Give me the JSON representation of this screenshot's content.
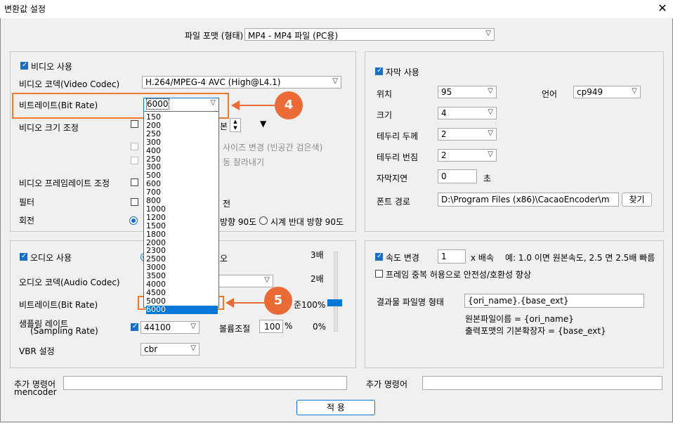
{
  "window": {
    "title": "변환값 설정",
    "close": "✕"
  },
  "format": {
    "label": "파일 포맷 (형태)",
    "value": "MP4 - MP4 파일 (PC용)"
  },
  "video": {
    "use_label": "비디오 사용",
    "codec_label": "비디오 코덱(Video Codec)",
    "codec_value": "H.264/MPEG-4 AVC (High@L4.1)",
    "bitrate_label": "비트레이트(Bit Rate)",
    "bitrate_value": "6000",
    "size_label": "비디오 크기 조정",
    "size_suffix": "본",
    "size_opt1": "사이즈 변경 (빈공간 검은색)",
    "size_opt2": "동 잘라내기",
    "framerate_label": "비디오 프레임레이트 조정",
    "filter_label": "필터",
    "filter_suffix": "전",
    "rotate_label": "회전",
    "rotate_opt_cw_partial": "방향 90도",
    "rotate_opt_ccw": "시계 반대 방향 90도",
    "bitrate_options": [
      "150",
      "200",
      "250",
      "300",
      "400",
      "250",
      "300",
      "500",
      "600",
      "700",
      "800",
      "1000",
      "1200",
      "1500",
      "1800",
      "2000",
      "2300",
      "2500",
      "3000",
      "3500",
      "4000",
      "4500",
      "5000",
      "6000"
    ]
  },
  "subtitle": {
    "use_label": "자막 사용",
    "position_label": "위치",
    "position_value": "95",
    "lang_label": "언어",
    "lang_value": "cp949",
    "size_label": "크기",
    "size_value": "4",
    "border_w_label": "테두리 두께",
    "border_w_value": "2",
    "border_b_label": "테두리 번짐",
    "border_b_value": "2",
    "delay_label": "자막지연",
    "delay_value": "0",
    "delay_unit": "초",
    "font_label": "폰트 경로",
    "font_value": "D:\\Program Files (x86)\\CacaoEncoder\\m",
    "browse_label": "찾기"
  },
  "audio": {
    "use_label": "오디오 사용",
    "use_suffix": "오",
    "codec_label": "오디오 코덱(Audio Codec)",
    "bitrate_label": "비트레이트(Bit Rate)",
    "bitrate_value": "6000",
    "sampling_label1": "샘플링 레이트",
    "sampling_label2": "(Sampling Rate)",
    "sampling_value": "44100",
    "volume_label": "볼륨조절",
    "volume_value": "100",
    "volume_unit": "%",
    "vbr_label": "VBR 설정",
    "vbr_value": "cbr",
    "scale_top": "3배",
    "scale_mid": "2배",
    "scale_ref": "준100%",
    "scale_bottom": "0%"
  },
  "speed": {
    "use_label": "속도 변경",
    "value": "1",
    "unit": "x 배속",
    "example": "예: 1.0 이면 원본속도, 2.5 면 2.5배 빠름",
    "frame_dup_label": "프레임 중복 허용으로 안전성/호환성 향상",
    "output_label": "결과물 파일명 형태",
    "output_value": "{ori_name}.{base_ext}",
    "note1": "원본파일이름 = {ori_name}",
    "note2": "출력포맷의 기본확장자 = {base_ext}"
  },
  "extra": {
    "left_label1": "추가 명령어",
    "left_label2": "mencoder",
    "right_label": "추가 명령어"
  },
  "apply_label": "적 용",
  "annotations": {
    "step4": "4",
    "step5": "5",
    "color": "#ea6b36"
  }
}
